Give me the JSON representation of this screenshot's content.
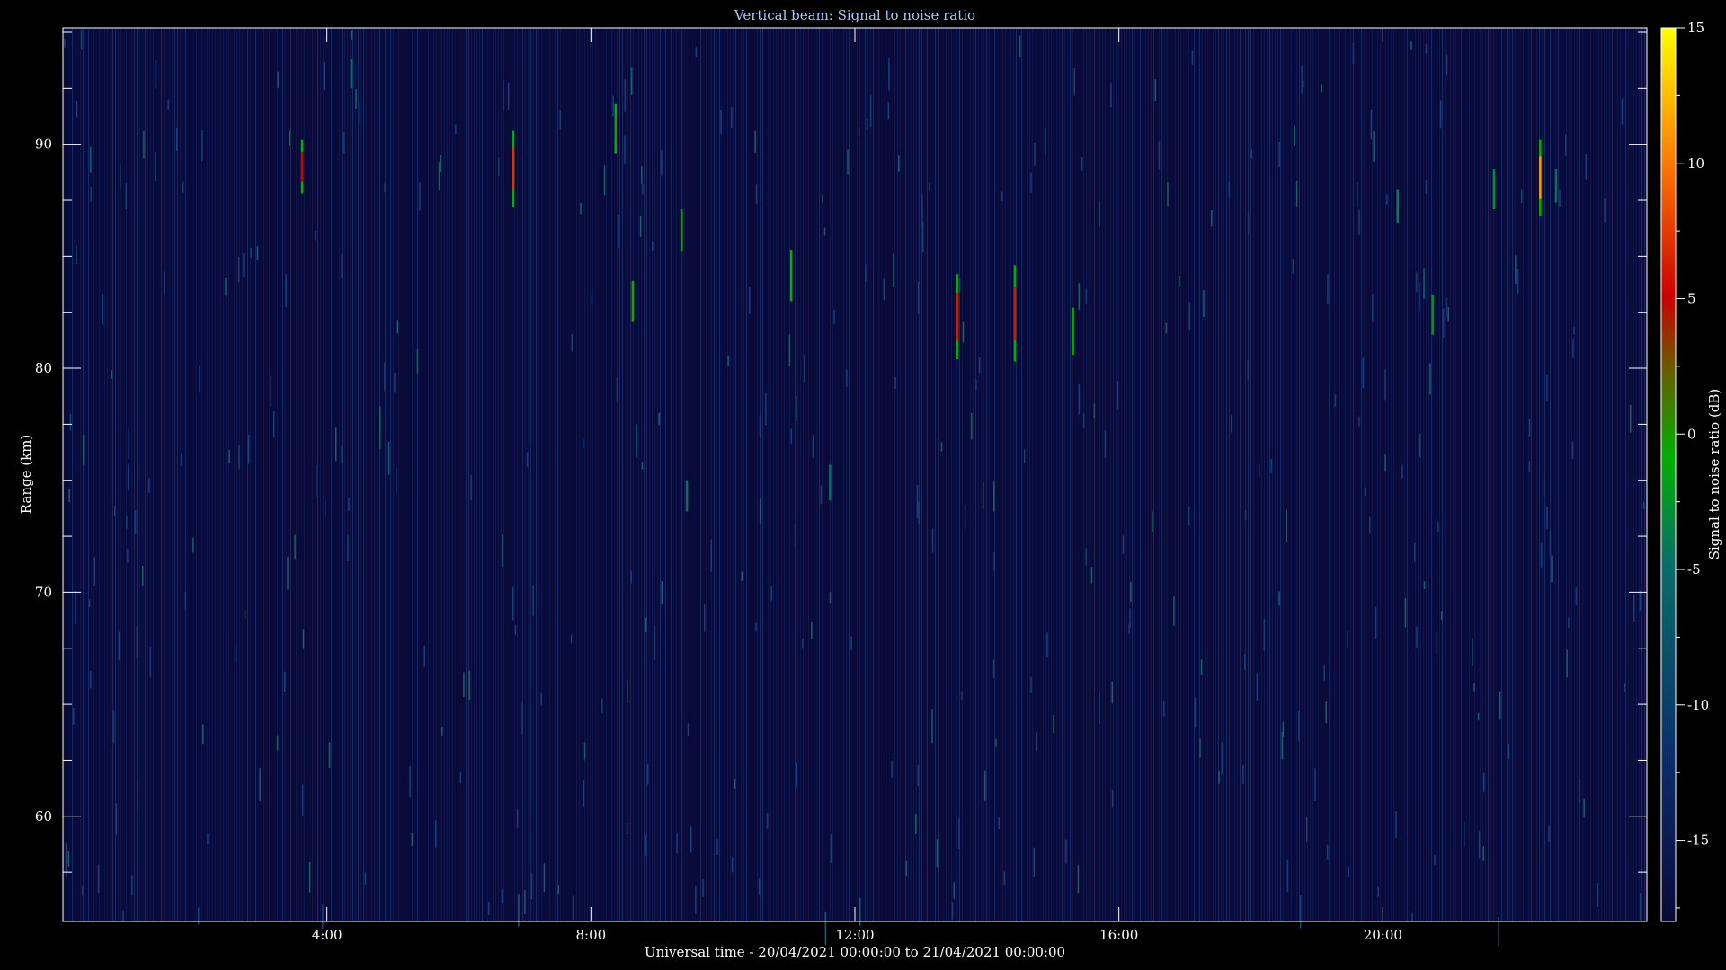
{
  "chart_data": {
    "type": "heatmap",
    "title": "Vertical beam: Signal to noise ratio",
    "xlabel": "Universal time - 20/04/2021 00:00:00 to 21/04/2021 00:00:00",
    "ylabel": "Range (km)",
    "colorbar_label": "Signal to noise ratio (dB)",
    "xlim_hours": [
      0,
      24
    ],
    "ylim_km": [
      55.3,
      95.2
    ],
    "clim_db": [
      -18,
      15
    ],
    "x_ticks": [
      {
        "hour": 4,
        "label": "4:00"
      },
      {
        "hour": 8,
        "label": "8:00"
      },
      {
        "hour": 12,
        "label": "12:00"
      },
      {
        "hour": 16,
        "label": "16:00"
      },
      {
        "hour": 20,
        "label": "20:00"
      }
    ],
    "y_ticks": [
      60,
      70,
      80,
      90
    ],
    "colorbar_ticks": [
      15,
      10,
      5,
      0,
      -5,
      -10,
      -15
    ],
    "colormap": [
      "#0a0a38",
      "#0b2c6a",
      "#0a6d6a",
      "#00b000",
      "#cc0000",
      "#ff7a00",
      "#ffff00"
    ],
    "background_level_db": -16,
    "echoes": [
      {
        "hour": 3.62,
        "range_top": 90.2,
        "range_bottom": 87.8,
        "peak_db": 2
      },
      {
        "hour": 4.37,
        "range_top": 93.8,
        "range_bottom": 92.5,
        "peak_db": -9
      },
      {
        "hour": 6.82,
        "range_top": 90.6,
        "range_bottom": 87.2,
        "peak_db": 4
      },
      {
        "hour": 8.37,
        "range_top": 91.8,
        "range_bottom": 89.6,
        "peak_db": -4
      },
      {
        "hour": 8.63,
        "range_top": 83.9,
        "range_bottom": 82.1,
        "peak_db": -5
      },
      {
        "hour": 9.37,
        "range_top": 87.1,
        "range_bottom": 85.2,
        "peak_db": -5
      },
      {
        "hour": 9.45,
        "range_top": 75.0,
        "range_bottom": 73.6,
        "peak_db": -9
      },
      {
        "hour": 11.03,
        "range_top": 85.3,
        "range_bottom": 83.0,
        "peak_db": -5
      },
      {
        "hour": 11.62,
        "range_top": 75.7,
        "range_bottom": 74.1,
        "peak_db": -9
      },
      {
        "hour": 13.55,
        "range_top": 84.2,
        "range_bottom": 80.4,
        "peak_db": 3
      },
      {
        "hour": 14.42,
        "range_top": 84.6,
        "range_bottom": 80.3,
        "peak_db": 3
      },
      {
        "hour": 15.3,
        "range_top": 82.7,
        "range_bottom": 80.6,
        "peak_db": -5
      },
      {
        "hour": 20.22,
        "range_top": 88.0,
        "range_bottom": 86.5,
        "peak_db": -8
      },
      {
        "hour": 20.75,
        "range_top": 83.3,
        "range_bottom": 81.5,
        "peak_db": -7
      },
      {
        "hour": 21.68,
        "range_top": 88.9,
        "range_bottom": 87.1,
        "peak_db": -7
      },
      {
        "hour": 22.38,
        "range_top": 90.2,
        "range_bottom": 86.8,
        "peak_db": 9
      },
      {
        "hour": 22.62,
        "range_top": 88.9,
        "range_bottom": 87.4,
        "peak_db": -9
      }
    ]
  }
}
